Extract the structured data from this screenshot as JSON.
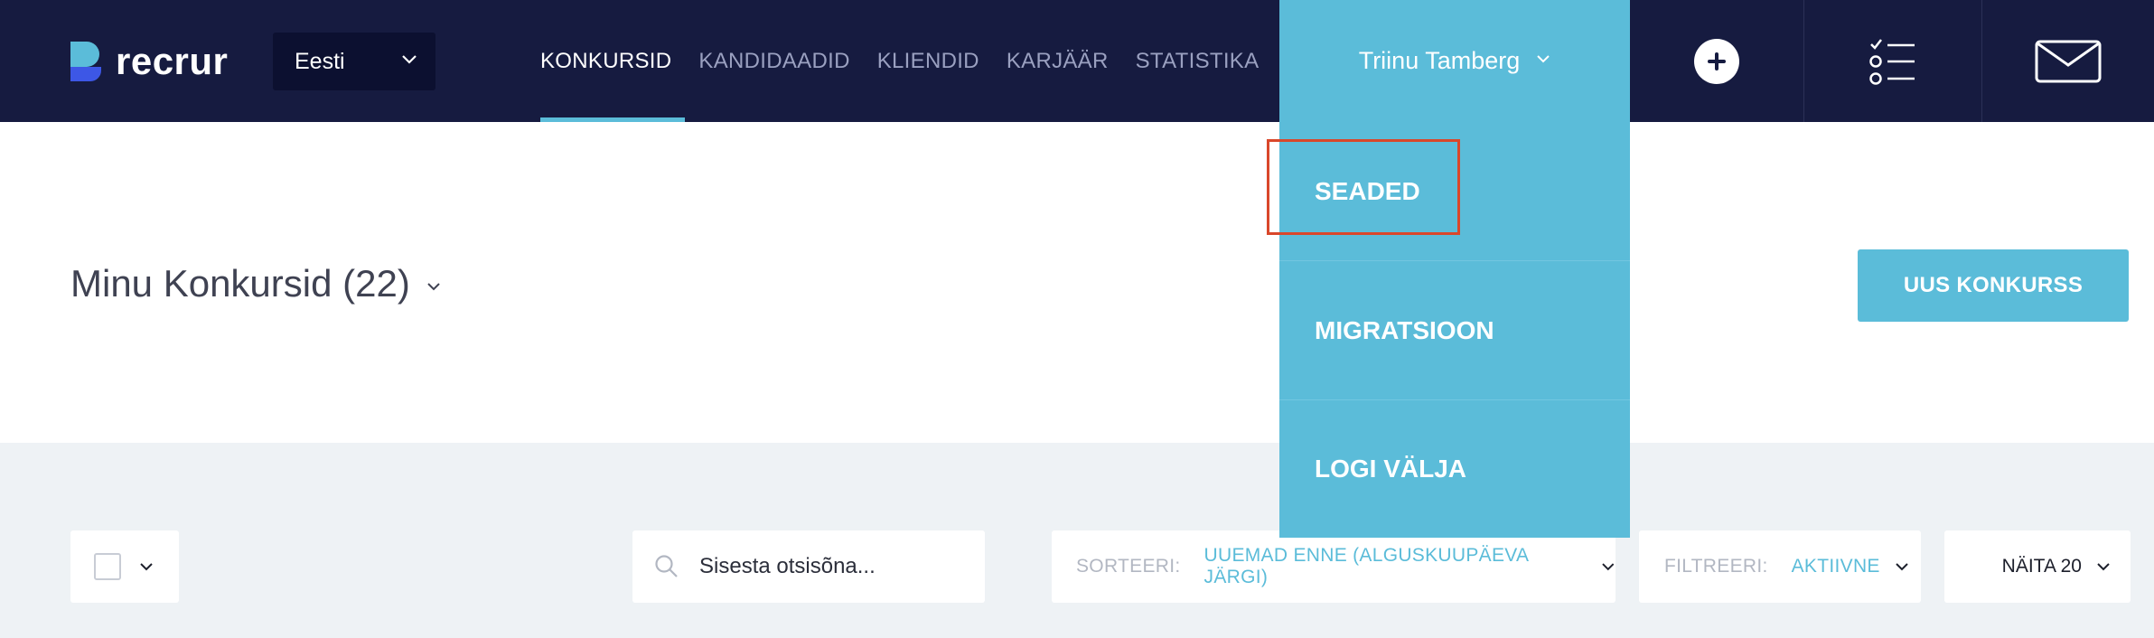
{
  "brand": {
    "name": "recrur"
  },
  "language": {
    "selected": "Eesti"
  },
  "nav": {
    "items": [
      {
        "label": "KONKURSID",
        "active": true
      },
      {
        "label": "KANDIDAADID",
        "active": false
      },
      {
        "label": "KLIENDID",
        "active": false
      },
      {
        "label": "KARJÄÄR",
        "active": false
      },
      {
        "label": "STATISTIKA",
        "active": false
      }
    ]
  },
  "user": {
    "name": "Triinu Tamberg"
  },
  "dropdown": {
    "items": [
      {
        "label": "SEADED"
      },
      {
        "label": "MIGRATSIOON"
      },
      {
        "label": "LOGI VÄLJA"
      }
    ]
  },
  "page": {
    "title": "Minu Konkursid (22)",
    "new_button": "UUS KONKURSS"
  },
  "toolbar": {
    "search_placeholder": "Sisesta otsisõna...",
    "sort_label": "SORTEERI:",
    "sort_value": "UUEMAD ENNE (ALGUSKUUPÄEVA JÄRGI)",
    "filter_label": "FILTREERI:",
    "filter_value": "AKTIIVNE",
    "show_label": "NÄITA 20"
  },
  "icons": {
    "add": "plus-icon",
    "tasks": "checklist-icon",
    "messages": "mail-icon"
  },
  "colors": {
    "nav_bg": "#161b40",
    "accent": "#5bbcd9",
    "highlight": "#d9472b"
  }
}
